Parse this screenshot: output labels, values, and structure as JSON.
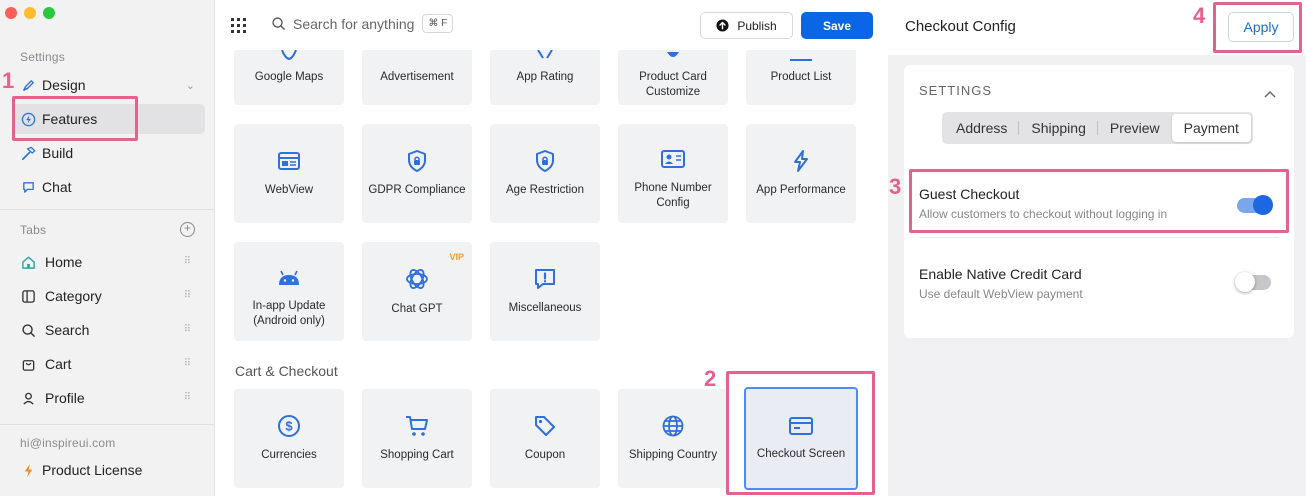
{
  "sidebar": {
    "settings_label": "Settings",
    "items": [
      {
        "label": "Design",
        "icon": "design-pen-icon"
      },
      {
        "label": "Features",
        "icon": "lightning-icon"
      },
      {
        "label": "Build",
        "icon": "hammer-icon"
      },
      {
        "label": "Chat",
        "icon": "chat-icon"
      }
    ],
    "tabs_label": "Tabs",
    "tabs": [
      {
        "label": "Home",
        "icon": "home-icon"
      },
      {
        "label": "Category",
        "icon": "category-icon"
      },
      {
        "label": "Search",
        "icon": "search-icon"
      },
      {
        "label": "Cart",
        "icon": "cart-icon"
      },
      {
        "label": "Profile",
        "icon": "profile-icon"
      }
    ],
    "email": "hi@inspireui.com",
    "license": "Product License"
  },
  "topbar": {
    "search_placeholder": "Search for anything",
    "shortcut": "⌘ F",
    "publish_label": "Publish",
    "save_label": "Save"
  },
  "cards_row1": [
    "Google Maps",
    "Advertisement",
    "App Rating",
    "Product Card Customize",
    "Product List"
  ],
  "cards_row2": [
    "WebView",
    "GDPR Compliance",
    "Age Restriction",
    "Phone Number Config",
    "App Performance"
  ],
  "cards_row3": [
    "In-app Update (Android only)",
    "Chat GPT",
    "Miscellaneous"
  ],
  "vip_badge": "VIP",
  "cart_checkout": {
    "title": "Cart & Checkout",
    "cards": [
      "Currencies",
      "Shopping Cart",
      "Coupon",
      "Shipping Country",
      "Checkout Screen"
    ]
  },
  "right_panel": {
    "title": "Checkout Config",
    "apply_label": "Apply",
    "settings_label": "SETTINGS",
    "segments": [
      "Address",
      "Shipping",
      "Preview",
      "Payment"
    ],
    "active_segment": "Payment",
    "guest_checkout": {
      "title": "Guest Checkout",
      "subtitle": "Allow customers to checkout without logging in",
      "enabled": true
    },
    "native_card": {
      "title": "Enable Native Credit Card",
      "subtitle": "Use default WebView payment",
      "enabled": false
    }
  },
  "annotations": [
    "1",
    "2",
    "3",
    "4"
  ],
  "colors": {
    "accent": "#0a66e4",
    "highlight": "#e8608c",
    "icon_blue": "#2f6fde"
  }
}
